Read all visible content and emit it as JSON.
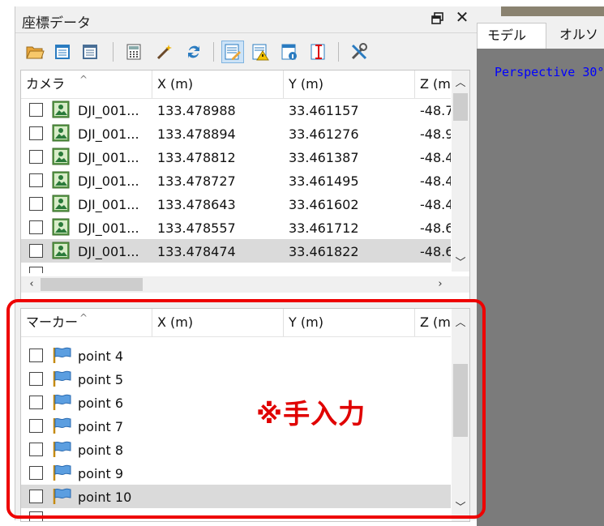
{
  "panel": {
    "title": "座標データ",
    "float_glyph": "🗗",
    "close_glyph": "✕"
  },
  "toolbar": {
    "buttons": [
      {
        "icon": "open-folder-icon"
      },
      {
        "icon": "import-table-icon"
      },
      {
        "icon": "export-table-icon"
      },
      {
        "icon": "calculator-icon"
      },
      {
        "icon": "wand-icon"
      },
      {
        "icon": "refresh-icon"
      },
      {
        "icon": "edit-table-icon",
        "active": true
      },
      {
        "icon": "warning-icon"
      },
      {
        "icon": "info-table-icon"
      },
      {
        "icon": "error-bar-icon"
      },
      {
        "icon": "tools-icon"
      }
    ]
  },
  "camera_table": {
    "columns": [
      "カメラ",
      "X (m)",
      "Y (m)",
      "Z (m"
    ],
    "rows": [
      {
        "name": "DJI_001...",
        "x": "133.478988",
        "y": "33.461157",
        "z": "-48.7"
      },
      {
        "name": "DJI_001...",
        "x": "133.478894",
        "y": "33.461276",
        "z": "-48.9"
      },
      {
        "name": "DJI_001...",
        "x": "133.478812",
        "y": "33.461387",
        "z": "-48.4"
      },
      {
        "name": "DJI_001...",
        "x": "133.478727",
        "y": "33.461495",
        "z": "-48.4"
      },
      {
        "name": "DJI_001...",
        "x": "133.478643",
        "y": "33.461602",
        "z": "-48.4"
      },
      {
        "name": "DJI_001...",
        "x": "133.478557",
        "y": "33.461712",
        "z": "-48.6"
      },
      {
        "name": "DJI_001...",
        "x": "133.478474",
        "y": "33.461822",
        "z": "-48.6",
        "selected": true
      }
    ]
  },
  "marker_table": {
    "columns": [
      "マーカー",
      "X (m)",
      "Y (m)",
      "Z (m"
    ],
    "rows": [
      {
        "name": "point 4"
      },
      {
        "name": "point 5"
      },
      {
        "name": "point 6"
      },
      {
        "name": "point 7"
      },
      {
        "name": "point 8"
      },
      {
        "name": "point 9"
      },
      {
        "name": "point 10",
        "selected": true
      }
    ]
  },
  "right_panel": {
    "tabs": [
      "モデル",
      "オルソ"
    ],
    "active_tab": 0,
    "viewport_label": "Perspective 30°"
  },
  "annotation": {
    "note": "※手入力",
    "color": "#e00000"
  },
  "colors": {
    "selection": "#dadada",
    "toolbar_active": "#cde3f7",
    "viewport_bg": "#7b7b7b",
    "viewport_text": "#0000ff"
  }
}
